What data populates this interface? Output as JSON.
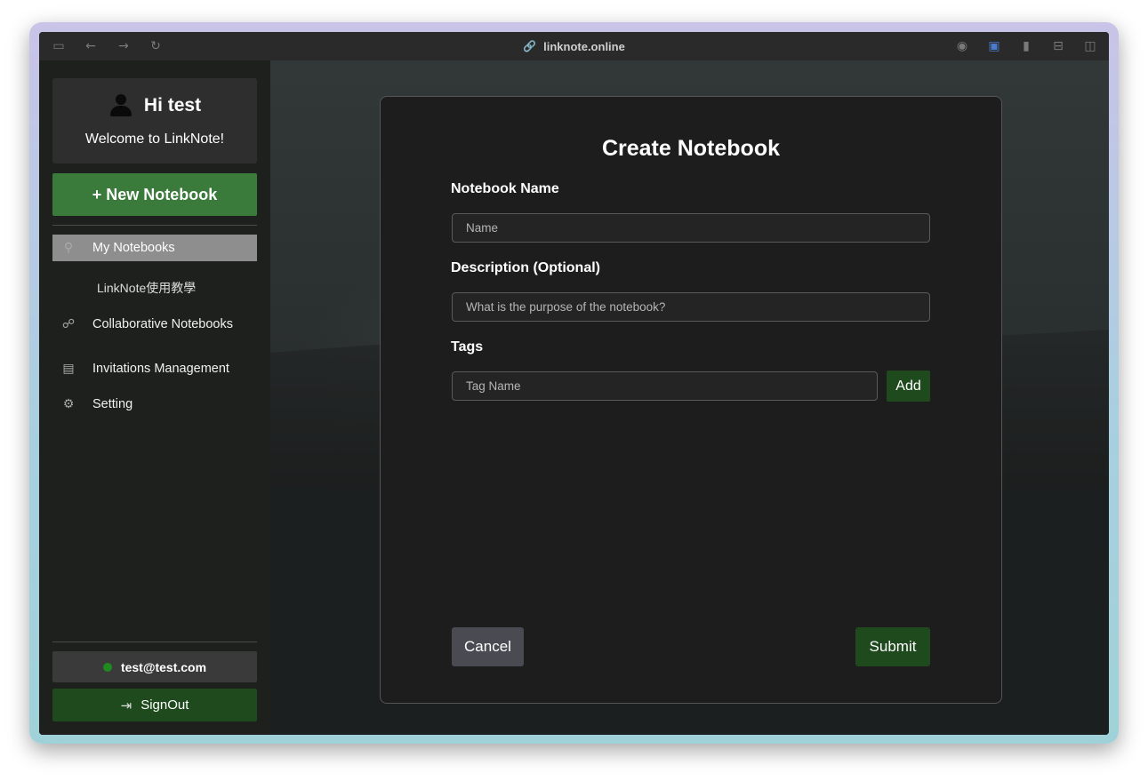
{
  "browser": {
    "url": "linknote.online",
    "icons": [
      "sidebar-toggle-icon",
      "back-arrow-icon",
      "forward-arrow-icon",
      "reload-icon",
      "link-icon",
      "camera-icon",
      "translate-icon",
      "extension-icon",
      "reader-icon",
      "split-view-icon"
    ]
  },
  "sidebar": {
    "greeting": "Hi test",
    "welcome": "Welcome to LinkNote!",
    "new_notebook": "+ New Notebook",
    "nav": {
      "my_notebooks": "My Notebooks",
      "sub_notebook": "LinkNote使用教學",
      "collaborative": "Collaborative Notebooks",
      "invitations": "Invitations Management",
      "setting": "Setting"
    },
    "user_email": "test@test.com",
    "status_color": "#1f8a1f",
    "signout": "SignOut"
  },
  "modal": {
    "title": "Create Notebook",
    "name_label": "Notebook Name",
    "name_placeholder": "Name",
    "name_value": "",
    "description_label": "Description (Optional)",
    "description_placeholder": "What is the purpose of the notebook?",
    "description_value": "",
    "tags_label": "Tags",
    "tag_placeholder": "Tag Name",
    "tag_value": "",
    "add_label": "Add",
    "cancel_label": "Cancel",
    "submit_label": "Submit"
  },
  "colors": {
    "accent_green": "#3a7a3a",
    "dark_green": "#1e4a1e",
    "active_nav": "#8e8e8e"
  }
}
